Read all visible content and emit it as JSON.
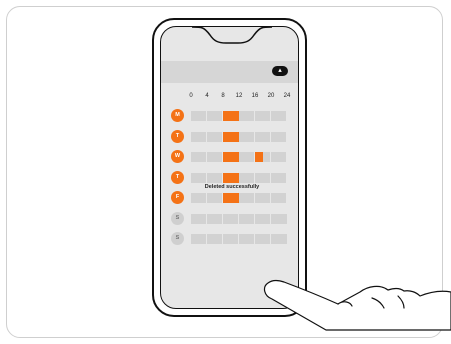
{
  "colors": {
    "accent": "#f47216",
    "inactive": "#cfcfcf",
    "track": "#d2d2d2"
  },
  "header": {
    "menu_icon": "chevron-up-icon"
  },
  "hour_labels": [
    "0",
    "4",
    "8",
    "12",
    "16",
    "20",
    "24"
  ],
  "days": [
    {
      "label": "M",
      "active": true,
      "slots": [
        [
          8,
          12
        ]
      ]
    },
    {
      "label": "T",
      "active": true,
      "slots": [
        [
          8,
          12
        ]
      ]
    },
    {
      "label": "W",
      "active": true,
      "slots": [
        [
          8,
          12
        ],
        [
          16,
          18
        ]
      ]
    },
    {
      "label": "T",
      "active": true,
      "slots": [
        [
          8,
          12
        ]
      ]
    },
    {
      "label": "F",
      "active": true,
      "slots": [
        [
          8,
          12
        ]
      ]
    },
    {
      "label": "S",
      "active": false,
      "slots": []
    },
    {
      "label": "S",
      "active": false,
      "slots": []
    }
  ],
  "toast": {
    "message": "Deleted successfully"
  }
}
